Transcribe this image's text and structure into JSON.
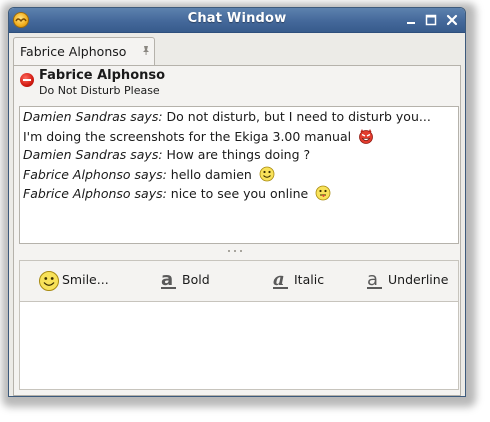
{
  "window": {
    "title": "Chat Window",
    "icons": {
      "app": "ekiga-app-icon",
      "minimize": "minimize-icon",
      "maximize": "maximize-icon",
      "close": "close-icon"
    }
  },
  "tabs": [
    {
      "label": "Fabrice Alphonso",
      "icon": "tab-close-icon"
    }
  ],
  "contact": {
    "name": "Fabrice Alphonso",
    "status": "Do Not Disturb Please",
    "status_icon": "do-not-disturb-icon",
    "status_color": "#d21b12"
  },
  "messages": [
    {
      "speaker": "Damien Sandras says:",
      "text": " Do not disturb, but I need to disturb you..."
    },
    {
      "speaker": "",
      "text": "I'm doing the screenshots for the Ekiga 3.00 manual",
      "emoticon": "devil-smiley-icon"
    },
    {
      "speaker": "Damien Sandras says:",
      "text": " How are things doing ?"
    },
    {
      "speaker": "Fabrice Alphonso says:",
      "text": " hello damien",
      "emoticon": "smile-smiley-icon"
    },
    {
      "speaker": "Fabrice Alphonso says:",
      "text": " nice to see you online",
      "emoticon": "tongue-smiley-icon"
    }
  ],
  "toolbar": {
    "smile": {
      "label": "Smile...",
      "icon": "smiley-icon"
    },
    "bold": {
      "label": "Bold",
      "icon": "bold-format-icon"
    },
    "italic": {
      "label": "Italic",
      "icon": "italic-format-icon"
    },
    "underline": {
      "label": "Underline",
      "icon": "underline-format-icon"
    }
  },
  "input": {
    "value": ""
  },
  "colors": {
    "titlebar": "#44689a",
    "accent": "#f5b323",
    "dnd": "#d21b12"
  }
}
